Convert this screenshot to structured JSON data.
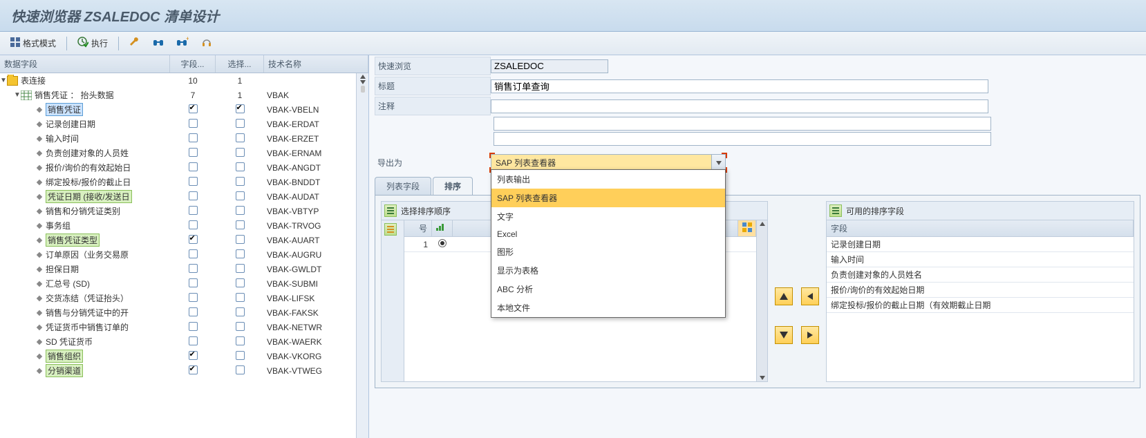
{
  "header": {
    "title": "快速浏览器 ZSALEDOC 清单设计"
  },
  "toolbar": {
    "format_mode": "格式模式",
    "execute": "执行"
  },
  "tree": {
    "headers": {
      "data_field": "数据字段",
      "field": "字段...",
      "select": "选择...",
      "tech_name": "技术名称"
    },
    "root": {
      "label": "表连接",
      "field_count": "10",
      "select_count": "1"
    },
    "table": {
      "label": "销售凭证 ： 抬头数据",
      "field_count": "7",
      "select_count": "1",
      "tech": "VBAK"
    },
    "rows": [
      {
        "label": "销售凭证",
        "hl": "blue",
        "ck1": true,
        "ck2": true,
        "tech": "VBAK-VBELN"
      },
      {
        "label": "记录创建日期",
        "ck1": false,
        "ck2": false,
        "tech": "VBAK-ERDAT"
      },
      {
        "label": "输入时间",
        "ck1": false,
        "ck2": false,
        "tech": "VBAK-ERZET"
      },
      {
        "label": "负责创建对象的人员姓",
        "ck1": false,
        "ck2": false,
        "tech": "VBAK-ERNAM"
      },
      {
        "label": "报价/询价的有效起始日",
        "ck1": false,
        "ck2": false,
        "tech": "VBAK-ANGDT"
      },
      {
        "label": "绑定投标/报价的截止日",
        "ck1": false,
        "ck2": false,
        "tech": "VBAK-BNDDT"
      },
      {
        "label": "凭证日期 (接收/发送日",
        "hl": "green",
        "ck1": false,
        "ck2": false,
        "tech": "VBAK-AUDAT"
      },
      {
        "label": "销售和分销凭证类别",
        "ck1": false,
        "ck2": false,
        "tech": "VBAK-VBTYP"
      },
      {
        "label": "事务组",
        "ck1": false,
        "ck2": false,
        "tech": "VBAK-TRVOG"
      },
      {
        "label": "销售凭证类型",
        "hl": "green",
        "ck1": true,
        "ck2": false,
        "tech": "VBAK-AUART"
      },
      {
        "label": "订单原因（业务交易原",
        "ck1": false,
        "ck2": false,
        "tech": "VBAK-AUGRU"
      },
      {
        "label": "担保日期",
        "ck1": false,
        "ck2": false,
        "tech": "VBAK-GWLDT"
      },
      {
        "label": "汇总号 (SD)",
        "ck1": false,
        "ck2": false,
        "tech": "VBAK-SUBMI"
      },
      {
        "label": "交货冻结（凭证抬头）",
        "ck1": false,
        "ck2": false,
        "tech": "VBAK-LIFSK"
      },
      {
        "label": "销售与分销凭证中的开",
        "ck1": false,
        "ck2": false,
        "tech": "VBAK-FAKSK"
      },
      {
        "label": "凭证货币中销售订单的",
        "ck1": false,
        "ck2": false,
        "tech": "VBAK-NETWR"
      },
      {
        "label": "SD 凭证货币",
        "ck1": false,
        "ck2": false,
        "tech": "VBAK-WAERK"
      },
      {
        "label": "销售组织",
        "hl": "green",
        "ck1": true,
        "ck2": false,
        "tech": "VBAK-VKORG"
      },
      {
        "label": "分销渠道",
        "hl": "green",
        "ck1": true,
        "ck2": false,
        "tech": "VBAK-VTWEG"
      }
    ]
  },
  "form": {
    "quick_view_label": "快速浏览",
    "quick_view_value": "ZSALEDOC",
    "title_label": "标题",
    "title_value": "销售订单查询",
    "comment_label": "注释",
    "comment_value": "",
    "export_label": "导出为",
    "export_selected": "SAP 列表查看器",
    "export_options": [
      "列表输出",
      "SAP 列表查看器",
      "文字",
      "Excel",
      "图形",
      "显示为表格",
      "ABC 分析",
      "本地文件"
    ]
  },
  "tabs": {
    "list_fields": "列表字段",
    "sort_order": "排序"
  },
  "left_panel": {
    "title": "选择排序顺序",
    "col_num": "号",
    "row_num": "1"
  },
  "right_panel": {
    "title": "可用的排序字段",
    "col_field": "字段",
    "rows": [
      "记录创建日期",
      "输入时间",
      "负责创建对象的人员姓名",
      "报价/询价的有效起始日期",
      "绑定投标/报价的截止日期（有效期截止日期"
    ]
  }
}
